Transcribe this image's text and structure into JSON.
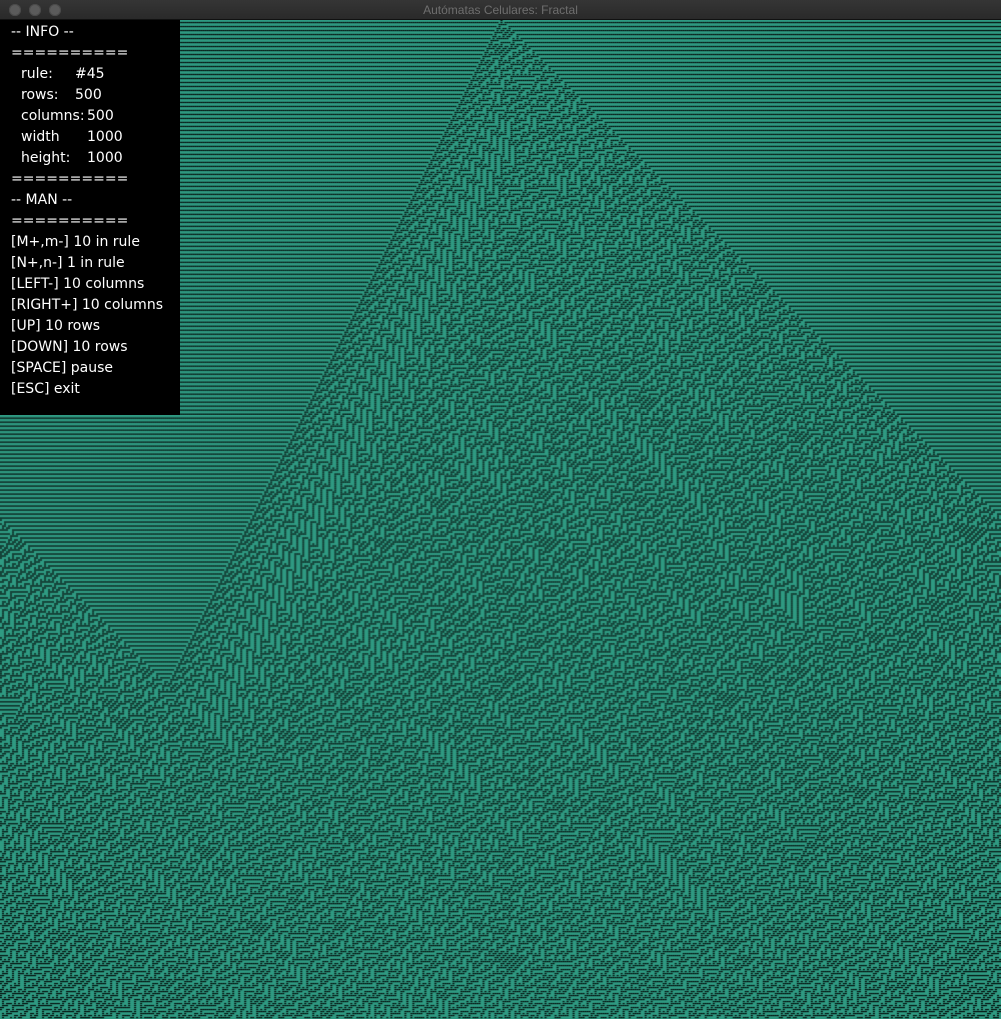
{
  "window": {
    "title": "Autómatas Celulares: Fractal"
  },
  "colors": {
    "alive": "#2f9a82",
    "dead": "#000000",
    "panel_bg": "#000000",
    "panel_text": "#ffffff",
    "titlebar": "#2c2c2c"
  },
  "automaton": {
    "rule": 45,
    "rows": 500,
    "columns": 500
  },
  "info": {
    "header": "-- INFO --",
    "separator": "==========",
    "rule_label": "rule:",
    "rule_value": "#45",
    "rows_label": "rows:",
    "rows_value": "500",
    "columns_label": "columns:",
    "columns_value": "500",
    "width_label": "width",
    "width_value": "1000",
    "height_label": "height:",
    "height_value": "1000"
  },
  "manual": {
    "header": "-- MAN --",
    "separator": "==========",
    "items": [
      "[M+,m-] 10 in rule",
      "[N+,n-] 1 in rule",
      "[LEFT-] 10 columns",
      "[RIGHT+] 10 columns",
      "[UP] 10 rows",
      "[DOWN] 10 rows",
      "[SPACE] pause",
      "[ESC] exit"
    ]
  }
}
